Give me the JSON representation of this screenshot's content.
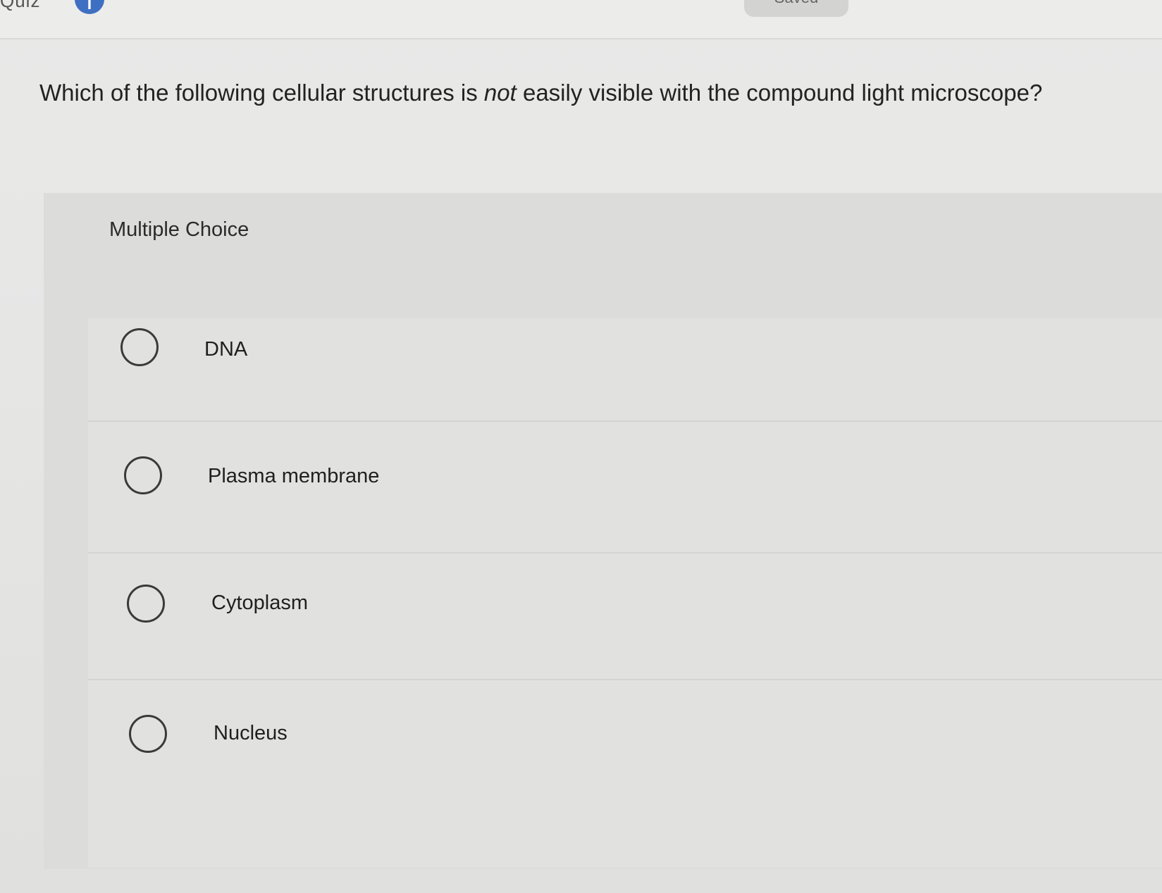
{
  "header": {
    "top_left_text": "Quiz",
    "info_badge": "i",
    "saved_label": "Saved"
  },
  "question": {
    "text_before": "Which of the following cellular structures is ",
    "text_emphasis": "not",
    "text_after": " easily visible with the compound light microscope?"
  },
  "question_type": "Multiple Choice",
  "choices": [
    {
      "label": "DNA",
      "selected": false
    },
    {
      "label": "Plasma membrane",
      "selected": false
    },
    {
      "label": "Cytoplasm",
      "selected": false
    },
    {
      "label": "Nucleus",
      "selected": false
    }
  ]
}
